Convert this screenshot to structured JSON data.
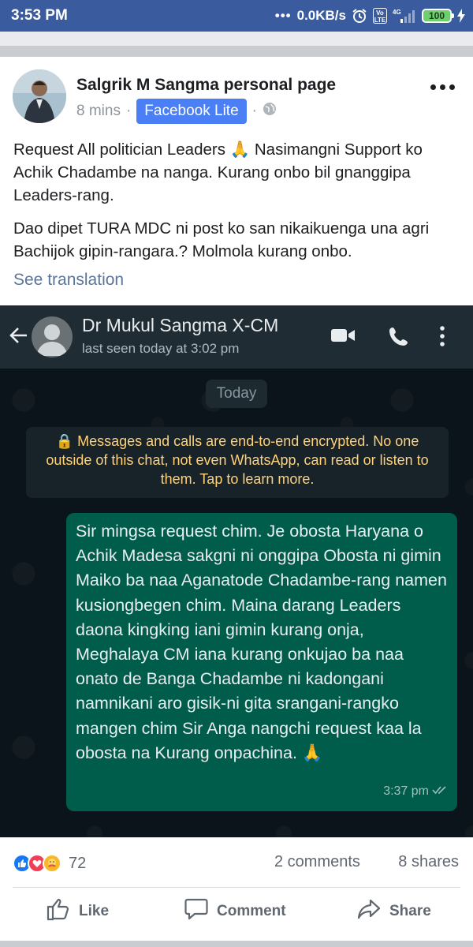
{
  "status_bar": {
    "time": "3:53 PM",
    "network_speed": "0.0KB/s",
    "volte": "Vo\nLTE",
    "signal_type": "4G",
    "battery": "100"
  },
  "post": {
    "author": "Salgrik M Sangma personal page",
    "time": "8 mins",
    "separator": "·",
    "via": "Facebook Lite",
    "paragraphs": [
      "Request All politician Leaders 🙏 Nasimangni Support ko Achik Chadambe na nanga. Kurang onbo bil gnanggipa Leaders-rang.",
      "Dao dipet TURA MDC ni post ko san nikaikuenga una agri Bachijok gipin-rangara.? Molmola kurang onbo."
    ],
    "see_translation": "See translation"
  },
  "whatsapp": {
    "contact_name": "Dr Mukul Sangma X-CM",
    "last_seen": "last seen today at 3:02 pm",
    "date_chip": "Today",
    "encryption_notice": "🔒 Messages and calls are end-to-end encrypted. No one outside of this chat, not even WhatsApp, can read or listen to them. Tap to learn more.",
    "message_text": "Sir mingsa request chim. Je obosta Haryana o Achik Madesa sakgni ni onggipa Obosta ni gimin Maiko ba naa Aganatode Chadambe-rang namen kusiongbegen chim. Maina darang Leaders daona kingking iani gimin kurang onja, Meghalaya CM iana kurang onkujao ba naa onato de Banga Chadambe ni kadongani namnikani aro gisik-ni gita srangani-rangko mangen chim Sir Anga nangchi request kaa la obosta na Kurang onpachina. 🙏",
    "message_time": "3:37 pm"
  },
  "engagement": {
    "reaction_count": "72",
    "comments": "2 comments",
    "shares": "8 shares"
  },
  "actions": {
    "like": "Like",
    "comment": "Comment",
    "share": "Share"
  },
  "colors": {
    "status_bar": "#3b5b9f",
    "facebook_lite_badge": "#4a7ff5",
    "whatsapp_header": "#1f2c33",
    "whatsapp_outgoing_bubble": "#005c4b",
    "encryption_text": "#ffd279",
    "link": "#5b7599"
  }
}
